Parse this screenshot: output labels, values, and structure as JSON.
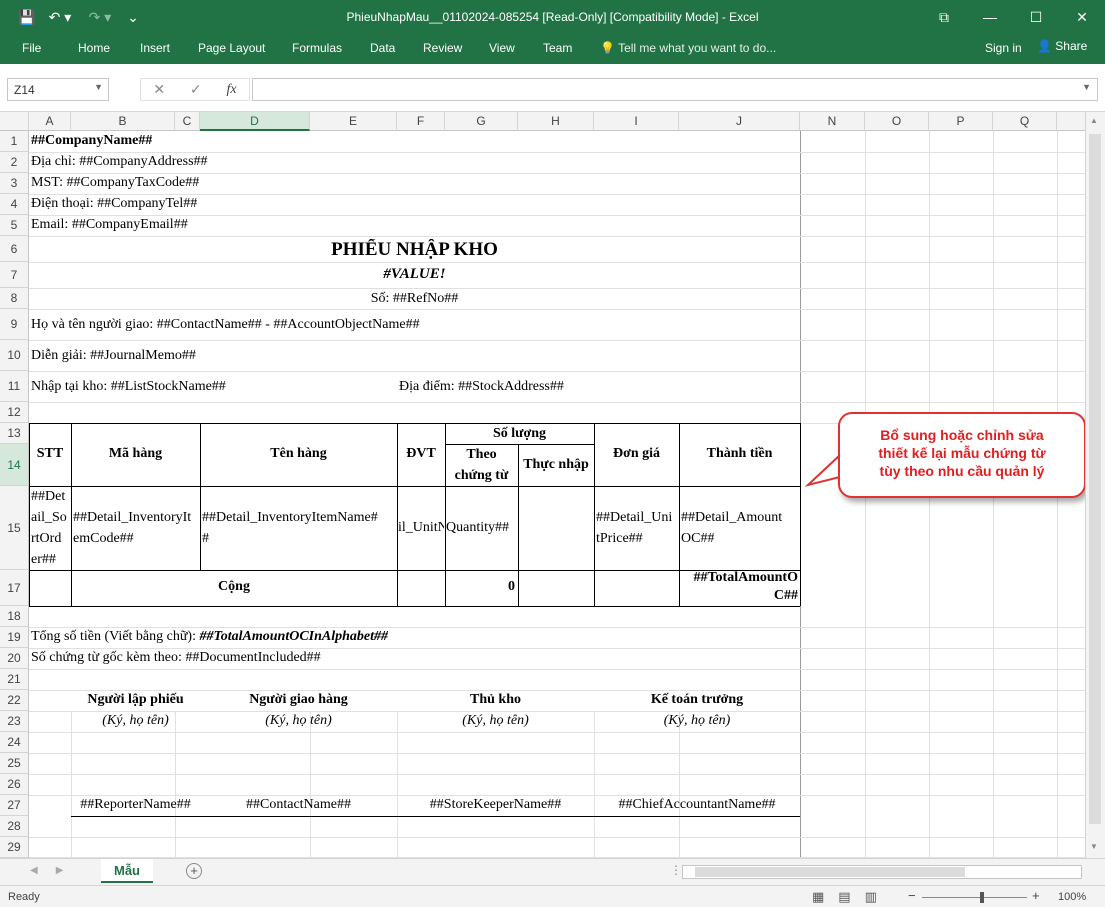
{
  "window": {
    "title": "PhieuNhapMau__01102024-085254  [Read-Only]  [Compatibility Mode] - Excel",
    "minimize": "—",
    "restore": "☐",
    "close": "✕",
    "ribbon_display": "⧉"
  },
  "qat": {
    "save": "💾",
    "undo": "↶ ▾",
    "redo": "↷ ▾",
    "customize": "⌄"
  },
  "ribbon": {
    "tabs": [
      "File",
      "Home",
      "Insert",
      "Page Layout",
      "Formulas",
      "Data",
      "Review",
      "View",
      "Team"
    ],
    "tell_me": "Tell me what you want to do...",
    "sign_in": "Sign in",
    "share": "Share"
  },
  "formula_bar": {
    "name_box": "Z14",
    "cancel": "✕",
    "enter": "✓",
    "fx": "fx",
    "value": ""
  },
  "columns": [
    "A",
    "B",
    "C",
    "D",
    "E",
    "F",
    "G",
    "H",
    "I",
    "J",
    "N",
    "O",
    "P",
    "Q"
  ],
  "rows": [
    "1",
    "2",
    "3",
    "4",
    "5",
    "6",
    "7",
    "8",
    "9",
    "10",
    "11",
    "12",
    "13",
    "14",
    "15",
    "17",
    "18",
    "19",
    "20",
    "21",
    "22",
    "23",
    "24",
    "25",
    "26",
    "27",
    "28",
    "29"
  ],
  "cells": {
    "company_name": "##CompanyName##",
    "address": "Địa chỉ: ##CompanyAddress##",
    "tax_code": "MST: ##CompanyTaxCode##",
    "tel": "Điện thoại: ##CompanyTel##",
    "email": "Email: ##CompanyEmail##",
    "doc_title": "PHIẾU NHẬP KHO",
    "value_error": "#VALUE!",
    "ref_no": "Số: ##RefNo##",
    "contact": "Họ và tên người giao: ##ContactName## - ##AccountObjectName##",
    "memo": "Diễn giải: ##JournalMemo##",
    "stock_name": "Nhập tại kho: ##ListStockName##",
    "stock_address": "Địa điểm: ##StockAddress##",
    "h_stt": "STT",
    "h_ma_hang": "Mã hàng",
    "h_ten_hang": "Tên hàng",
    "h_dvt": "ĐVT",
    "h_so_luong": "Số lượng",
    "h_theo_ct_1": "Theo",
    "h_theo_ct_2": "chứng từ",
    "h_thuc_nhap": "Thực nhập",
    "h_don_gia": "Đơn giá",
    "h_thanh_tien": "Thành tiền",
    "d_stt_1": "##Det",
    "d_stt_2": "ail_So",
    "d_stt_3": "rtOrd",
    "d_stt_4": "er##",
    "d_code_1": "##Detail_InventoryIt",
    "d_code_2": "emCode##",
    "d_name_1": "##Detail_InventoryItemName#",
    "d_name_2": "#",
    "d_unit": "il_UnitN",
    "d_qty": "Quantity##",
    "d_price_1": "##Detail_Uni",
    "d_price_2": "tPrice##",
    "d_amount_1": "##Detail_Amount",
    "d_amount_2": "OC##",
    "total_label": "Cộng",
    "total_qty": "0",
    "total_amount_1": "##TotalAmountO",
    "total_amount_2": "C##",
    "total_words_prefix": "Tổng số tiền (Viết bằng chữ): ",
    "total_words_value": "##TotalAmountOCInAlphabet##",
    "doc_included": "Số chứng từ gốc kèm theo: ##DocumentIncluded##",
    "sig_reporter": "Người lập phiếu",
    "sig_deliverer": "Người giao hàng",
    "sig_storekeeper": "Thủ kho",
    "sig_accountant": "Kế toán trưởng",
    "sig_note": "(Ký, họ tên)",
    "name_reporter": "##ReporterName##",
    "name_contact": "##ContactName##",
    "name_storekeeper": "##StoreKeeperName##",
    "name_accountant": "##ChiefAccountantName##"
  },
  "callout": {
    "line1": "Bổ sung hoặc chỉnh sửa",
    "line2": "thiết kế lại mẫu chứng từ",
    "line3": "tùy theo nhu cầu quản lý"
  },
  "sheet_tab": "Mẫu",
  "add_sheet": "+",
  "status": {
    "ready": "Ready",
    "zoom": "100%",
    "zoom_minus": "−",
    "zoom_plus": "+"
  }
}
